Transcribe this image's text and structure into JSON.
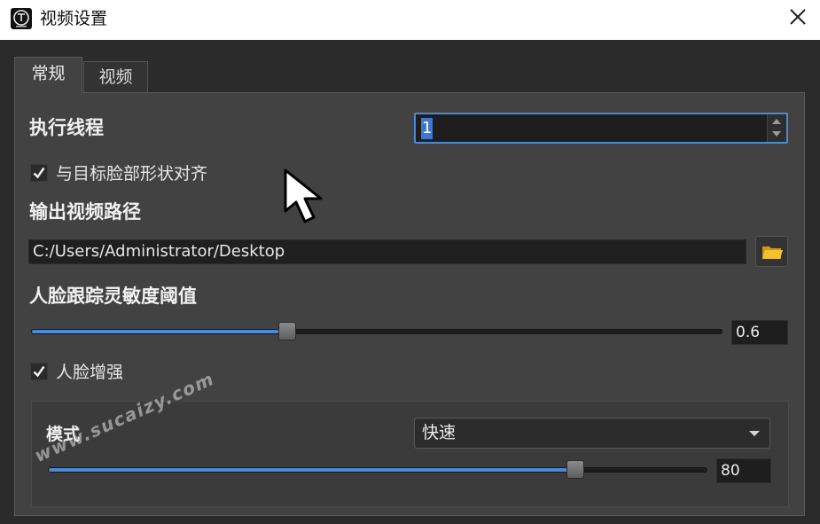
{
  "window": {
    "title": "视频设置"
  },
  "tabs": [
    {
      "label": "常规",
      "active": true
    },
    {
      "label": "视频",
      "active": false
    }
  ],
  "general": {
    "threads": {
      "label": "执行线程",
      "value": "1"
    },
    "align_face": {
      "label": "与目标脸部形状对齐",
      "checked": true
    },
    "output_path": {
      "label": "输出视频路径",
      "value": "C:/Users/Administrator/Desktop"
    },
    "tracking_threshold": {
      "label": "人脸跟踪灵敏度阈值",
      "value": "0.6",
      "fraction": 0.37
    },
    "face_enhance": {
      "label": "人脸增强",
      "checked": true,
      "mode_label": "模式",
      "mode_value": "快速",
      "strength_value": "80",
      "strength_fraction": 0.8
    }
  },
  "watermark": "www.sucaizy.com",
  "colors": {
    "accent": "#4a8ad8",
    "background": "#2b2b2b",
    "panel": "#424242",
    "titlebar": "#ffffff",
    "folder": "#f2c12e"
  }
}
